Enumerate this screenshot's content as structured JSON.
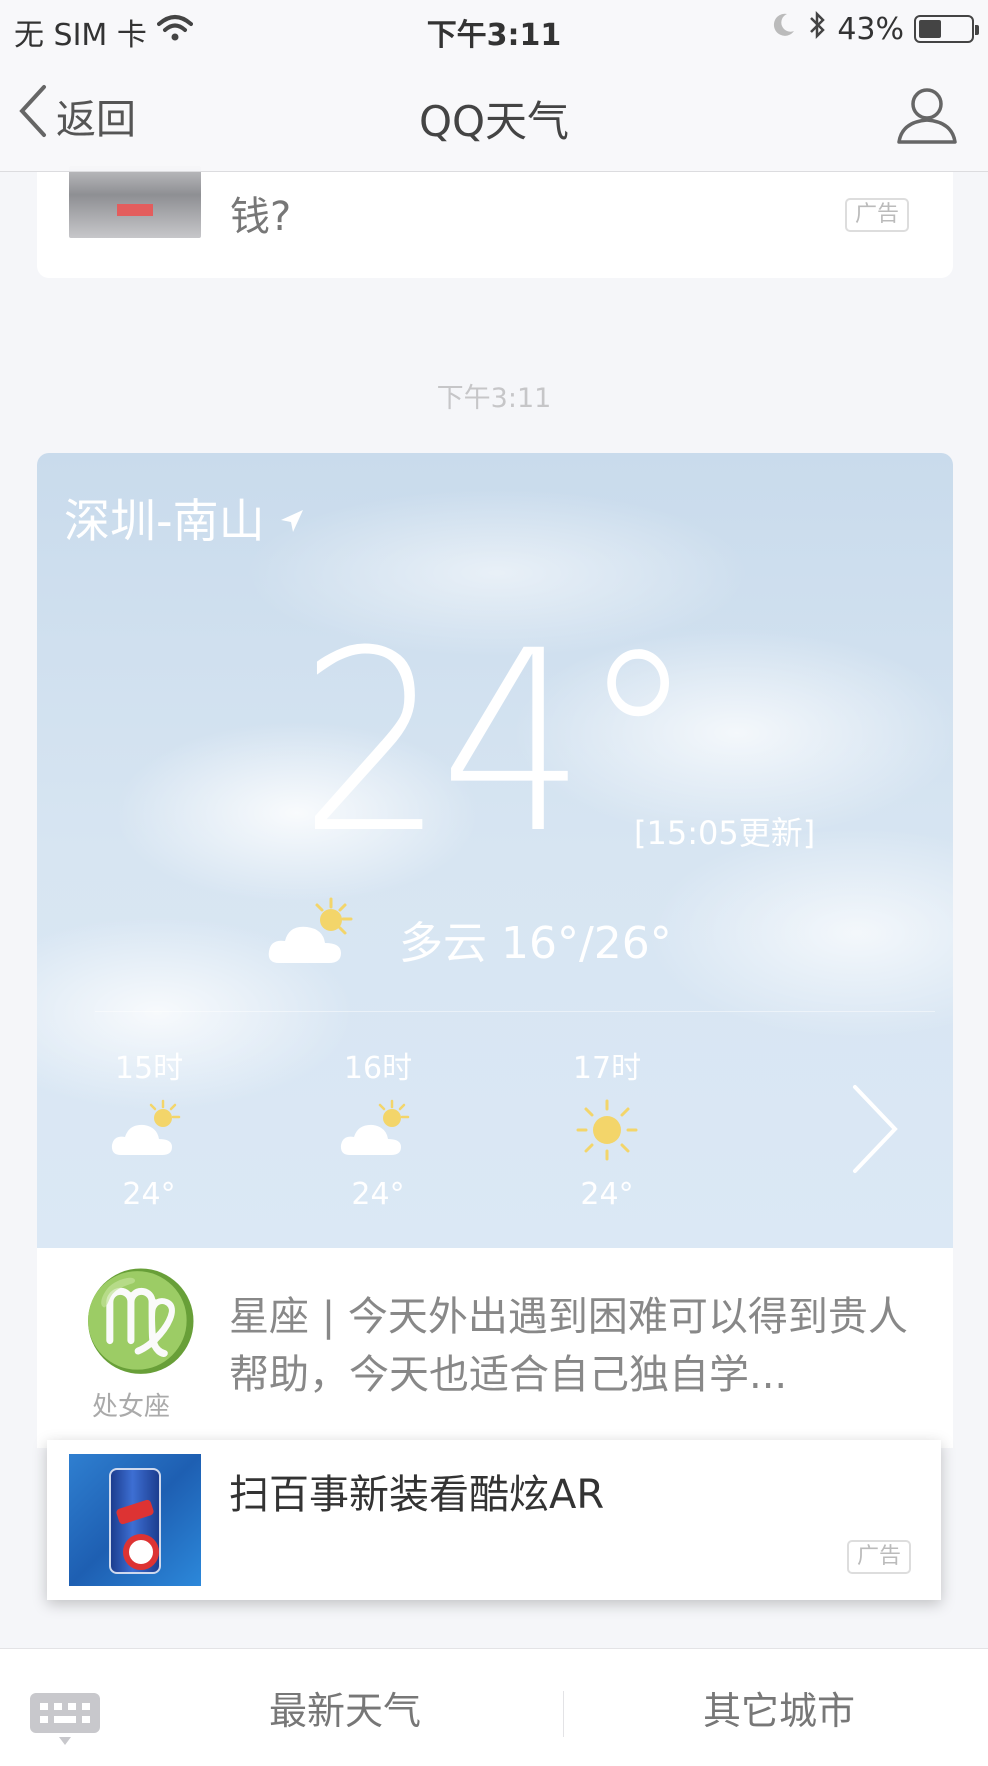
{
  "status_bar": {
    "carrier": "无 SIM 卡",
    "time": "下午3:11",
    "battery": "43%",
    "battery_level": 0.43
  },
  "nav": {
    "back_label": "返回",
    "title": "QQ天气"
  },
  "previous_ad": {
    "text": "钱?",
    "badge": "广告"
  },
  "message_time": "下午3:11",
  "weather": {
    "location": "深圳-南山",
    "temperature": "24°",
    "updated": "[15:05更新]",
    "condition": "多云 16°/26°",
    "hourly": [
      {
        "hour": "15时",
        "icon": "partly-cloudy-icon",
        "temp": "24°"
      },
      {
        "hour": "16时",
        "icon": "partly-cloudy-icon",
        "temp": "24°"
      },
      {
        "hour": "17时",
        "icon": "sunny-icon",
        "temp": "24°"
      }
    ]
  },
  "horoscope": {
    "symbol": "♍",
    "sign": "处女座",
    "text": "星座 | 今天外出遇到困难可以得到贵人帮助，今天也适合自己独自学..."
  },
  "ad": {
    "title": "扫百事新装看酷炫AR",
    "badge": "广告"
  },
  "tabs": {
    "latest": "最新天气",
    "other_cities": "其它城市"
  },
  "colors": {
    "sky": "#d4e3f1",
    "sun": "#f3d56a",
    "text_dark": "#333333",
    "text_gray": "#888888"
  }
}
